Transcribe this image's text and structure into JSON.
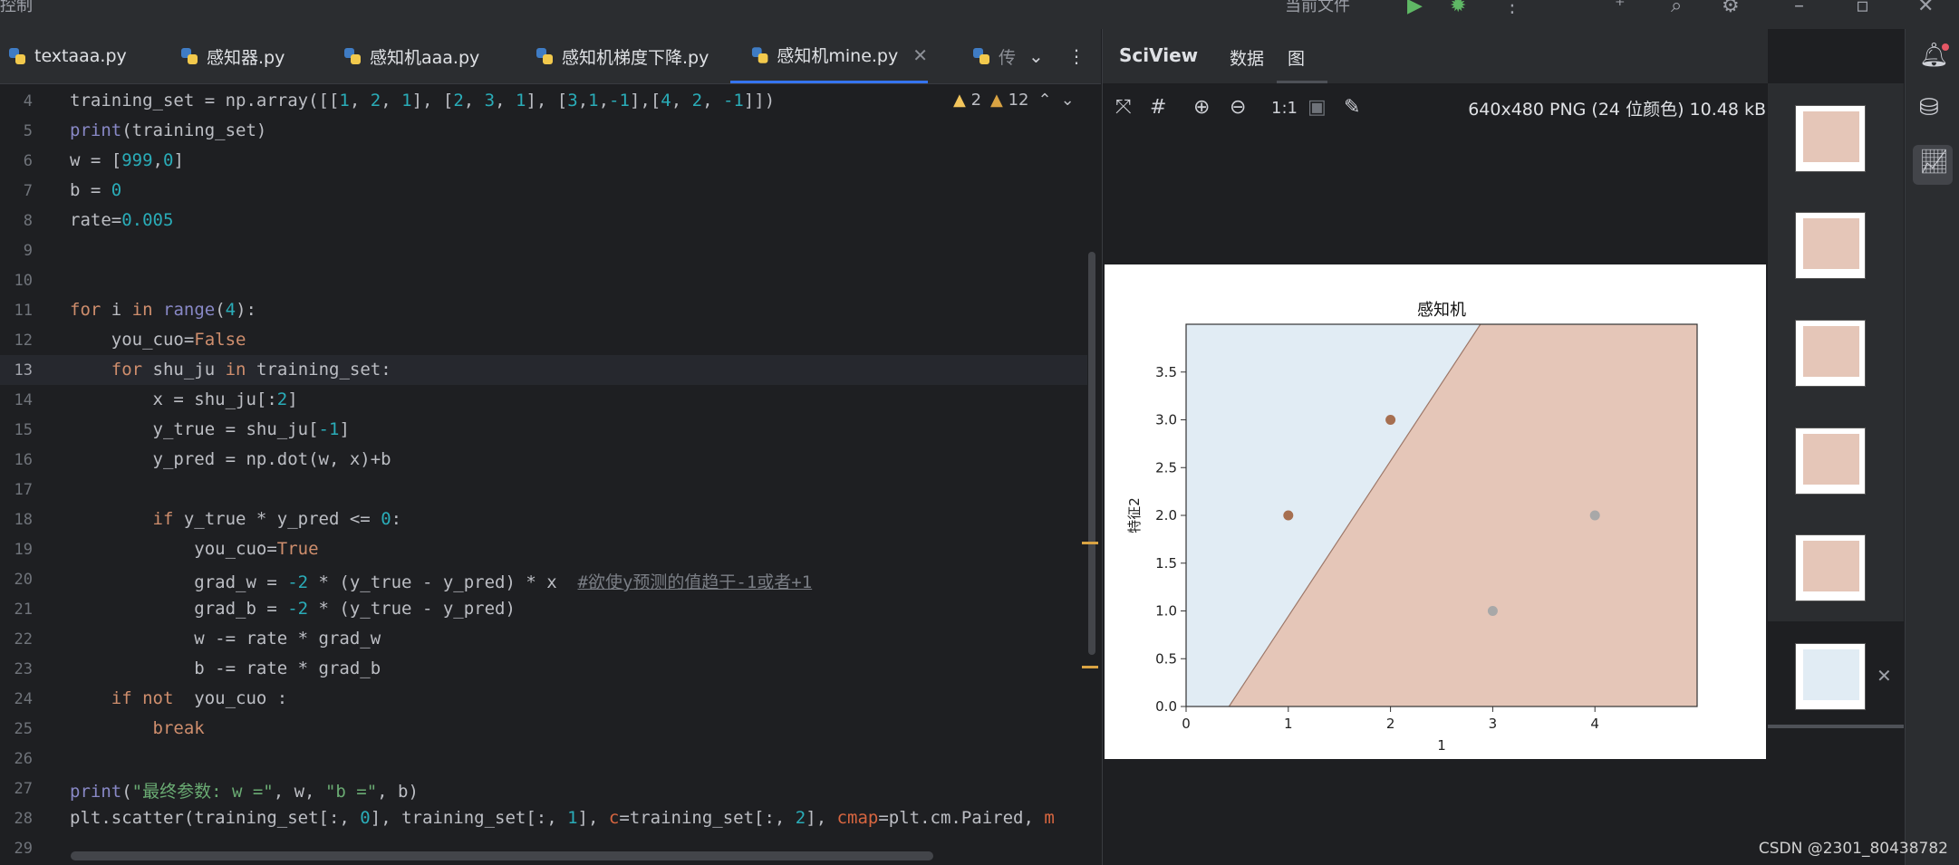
{
  "window": {
    "menu_label": "控制",
    "scope_label": "当前文件"
  },
  "tabs": [
    {
      "label": "textaaa.py"
    },
    {
      "label": "感知器.py"
    },
    {
      "label": "感知机aaa.py"
    },
    {
      "label": "感知机梯度下降.py"
    },
    {
      "label": "感知机mine.py",
      "active": true
    },
    {
      "label": "传"
    }
  ],
  "editor": {
    "current_line": "13",
    "line_numbers": [
      "4",
      "5",
      "6",
      "7",
      "8",
      "9",
      "10",
      "11",
      "12",
      "13",
      "14",
      "15",
      "16",
      "17",
      "18",
      "19",
      "20",
      "21",
      "22",
      "23",
      "24",
      "25",
      "26",
      "27",
      "28",
      "29"
    ],
    "warnings_yellow": "2",
    "warnings_orange": "12",
    "lines": {
      "l4_a": "training_set = np.array([[",
      "l4_b": "1",
      "l4_c": ", ",
      "l4_d": "2",
      "l4_e": ", ",
      "l4_f": "1",
      "l4_g": "], [",
      "l4_h": "2",
      "l4_i": ", ",
      "l4_j": "3",
      "l4_k": ", ",
      "l4_l": "1",
      "l4_m": "], [",
      "l4_n": "3",
      "l4_o": ",",
      "l4_p": "1",
      "l4_q": ",",
      "l4_r": "-1",
      "l4_s": "],[",
      "l4_t": "4",
      "l4_u": ", ",
      "l4_v": "2",
      "l4_w": ", ",
      "l4_x": "-1",
      "l4_y": "]])",
      "l5_a": "print",
      "l5_b": "(training_set)",
      "l6_a": "w = [",
      "l6_b": "999",
      "l6_c": ",",
      "l6_d": "0",
      "l6_e": "]",
      "l7_a": "b = ",
      "l7_b": "0",
      "l8_a": "rate=",
      "l8_b": "0.005",
      "l11_a": "for",
      "l11_b": " i ",
      "l11_c": "in",
      "l11_d": " ",
      "l11_e": "range",
      "l11_f": "(",
      "l11_g": "4",
      "l11_h": "):",
      "l12_a": "    you_cuo=",
      "l12_b": "False",
      "l13_a": "    ",
      "l13_b": "for",
      "l13_c": " shu_ju ",
      "l13_d": "in",
      "l13_e": " training_set:",
      "l14_a": "        x = shu_ju[:",
      "l14_b": "2",
      "l14_c": "]",
      "l15_a": "        y_true = shu_ju[",
      "l15_b": "-1",
      "l15_c": "]",
      "l16": "        y_pred = np.dot(w, x)+b",
      "l18_a": "        ",
      "l18_b": "if",
      "l18_c": " y_true * y_pred <= ",
      "l18_d": "0",
      "l18_e": ":",
      "l19_a": "            you_cuo=",
      "l19_b": "True",
      "l20_a": "            grad_w = ",
      "l20_b": "-2",
      "l20_c": " * (y_true - y_pred) * x  ",
      "l20_d": "#欲使y预测的值趋于-1或者+1",
      "l21_a": "            grad_b = ",
      "l21_b": "-2",
      "l21_c": " * (y_true - y_pred)",
      "l22": "            w -= rate * grad_w",
      "l23": "            b -= rate * grad_b",
      "l24_a": "    ",
      "l24_b": "if not",
      "l24_c": "  you_cuo :",
      "l25_a": "        ",
      "l25_b": "break",
      "l27_a": "print",
      "l27_b": "(",
      "l27_c": "\"最终参数: w =\"",
      "l27_d": ", w, ",
      "l27_e": "\"b =\"",
      "l27_f": ", b)",
      "l28_a": "plt.scatter(training_set[:, ",
      "l28_b": "0",
      "l28_c": "], training_set[:, ",
      "l28_d": "1",
      "l28_e": "], ",
      "l28_f": "c",
      "l28_g": "=training_set[:, ",
      "l28_h": "2",
      "l28_i": "], ",
      "l28_j": "cmap",
      "l28_k": "=plt.cm.Paired, ",
      "l28_l": "m"
    }
  },
  "sciview": {
    "title": "SciView",
    "tab_data": "数据",
    "tab_plots": "图",
    "zoom_label": "1:1",
    "image_info": "640x480 PNG (24 位颜色) 10.48 kB"
  },
  "thumbnails_count_label": "",
  "watermark": "CSDN @2301_80438782",
  "colors": {
    "region_neg": "#e1ecf4",
    "region_pos": "#e5c6b8",
    "point_neg": "#a8a8a8",
    "point_pos": "#a66f50",
    "accent": "#3574f0"
  },
  "chart_data": {
    "type": "scatter",
    "title": "感知机",
    "xlabel": "1",
    "ylabel": "特征2",
    "xlim": [
      0,
      5
    ],
    "ylim": [
      0,
      4
    ],
    "xticks": [
      "0",
      "1",
      "2",
      "3",
      "4"
    ],
    "yticks": [
      "0.0",
      "0.5",
      "1.0",
      "1.5",
      "2.0",
      "2.5",
      "3.0",
      "3.5"
    ],
    "boundary": {
      "x": [
        0.42,
        2.88
      ],
      "y": [
        0,
        4
      ]
    },
    "series": [
      {
        "name": "",
        "x": [
          1,
          2
        ],
        "y": [
          2,
          3
        ],
        "label": "1"
      },
      {
        "name": "",
        "x": [
          3,
          4
        ],
        "y": [
          1,
          2
        ],
        "label": "-1"
      }
    ]
  }
}
